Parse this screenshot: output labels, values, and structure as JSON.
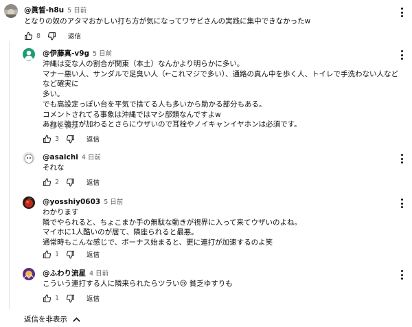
{
  "top_comment": {
    "author": "@眞皙-h8u",
    "time": "5 日前",
    "text": "となりの奴のアタマおかしい打ち方が気になってワサビさんの実践に集中できなかったw",
    "likes": "8",
    "reply_label": "返信"
  },
  "replies": [
    {
      "author": "@伊藤真-v9g",
      "time": "5 日前",
      "text": "沖縄は変な人の割合が関東（本土）なんかより明らかに多い。\nマナー悪い人、サンダルで足臭い人（←これマジで多い）、通路の真ん中を歩く人、トイレで手洗わない人などなど確実に\n多い。\nでも高設定っぽい台を平気で捨てる人も多いから助かる部分もある。\nコメントされてる事象は沖縄ではマシ部類なんですよw\nあれに強打が加わるとさらにウザいので耳栓やノイキャンイヤホンは必須です。",
      "read_more": "一部を表示",
      "likes": "3",
      "reply_label": "返信"
    },
    {
      "author": "@asaichi",
      "time": "4 日前",
      "text": "それな",
      "likes": "2",
      "reply_label": "返信"
    },
    {
      "author": "@yosshiy0603",
      "time": "5 日前",
      "text": "わかります\n隣でやられると、ちょこまか手の無駄な動きが視界に入って来てウザいのよね。\nマイホに1人酷いのが居て、隣座られると最悪。\n通常時もこんな感じで、ボーナス始まると、更に連打が加速するのよ笑",
      "likes": "1",
      "reply_label": "返信"
    },
    {
      "author": "@ふわり流星",
      "time": "4 日前",
      "text": "こういう連打する人に隣来られたらツラい😢 貧乏ゆすりも",
      "likes": "1",
      "reply_label": "返信"
    }
  ],
  "hide_replies_label": "返信を非表示",
  "colors": {
    "text": "#0f0f0f",
    "secondary": "#606060",
    "divider": "#e5e5e5"
  },
  "icons": [
    "thumb-up-icon",
    "thumb-down-icon",
    "more-vert-icon",
    "chevron-up-icon"
  ]
}
